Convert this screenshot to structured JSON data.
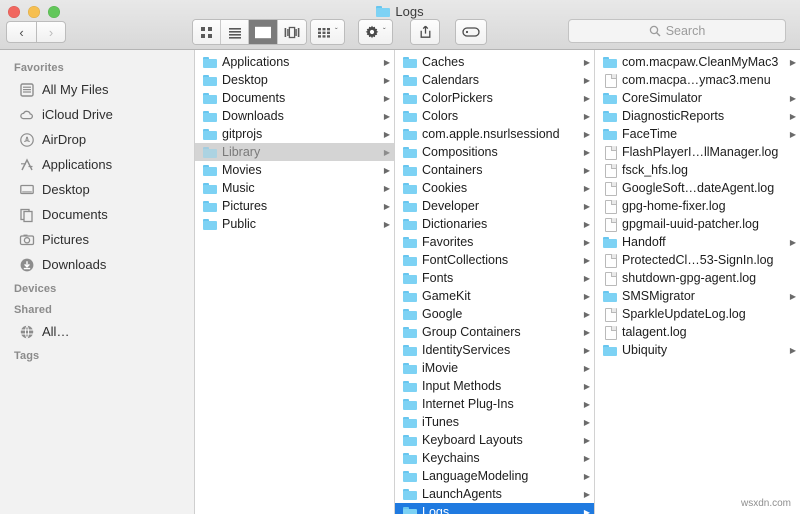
{
  "window": {
    "title": "Logs",
    "title_icon": "folder-icon",
    "traffic_lights": [
      {
        "name": "close-button",
        "color": "#f1675f"
      },
      {
        "name": "minimize-button",
        "color": "#f6bf50"
      },
      {
        "name": "maximize-button",
        "color": "#62c75a"
      }
    ]
  },
  "toolbar": {
    "back_label": "‹",
    "forward_label": "›",
    "views": [
      {
        "name": "icon-view-button",
        "icon": "grid-icon",
        "active": false
      },
      {
        "name": "list-view-button",
        "icon": "list-icon",
        "active": false
      },
      {
        "name": "column-view-button",
        "icon": "columns-icon",
        "active": true
      },
      {
        "name": "coverflow-view-button",
        "icon": "coverflow-icon",
        "active": false
      }
    ],
    "arrange_label": "",
    "arrange_icon": "arrange-icon",
    "action_icon": "gear-icon",
    "share_icon": "share-icon",
    "tag_icon": "tag-icon",
    "chevron": "ˇ"
  },
  "search": {
    "placeholder": "Search",
    "icon": "search-icon",
    "value": ""
  },
  "sidebar": {
    "sections": [
      {
        "header": "Favorites",
        "items": [
          {
            "label": "All My Files",
            "icon": "all-my-files-icon"
          },
          {
            "label": "iCloud Drive",
            "icon": "cloud-icon"
          },
          {
            "label": "AirDrop",
            "icon": "airdrop-icon"
          },
          {
            "label": "Applications",
            "icon": "applications-icon"
          },
          {
            "label": "Desktop",
            "icon": "desktop-icon"
          },
          {
            "label": "Documents",
            "icon": "documents-icon"
          },
          {
            "label": "Pictures",
            "icon": "pictures-icon"
          },
          {
            "label": "Downloads",
            "icon": "downloads-icon"
          }
        ]
      },
      {
        "header": "Devices",
        "items": []
      },
      {
        "header": "Shared",
        "items": [
          {
            "label": "All…",
            "icon": "globe-icon"
          }
        ]
      },
      {
        "header": "Tags",
        "items": []
      }
    ]
  },
  "columns": [
    {
      "name": "column-home",
      "items": [
        {
          "label": "Applications",
          "type": "folder",
          "arrow": true,
          "selected": "none"
        },
        {
          "label": "Desktop",
          "type": "folder",
          "arrow": true,
          "selected": "none"
        },
        {
          "label": "Documents",
          "type": "folder",
          "arrow": true,
          "selected": "none"
        },
        {
          "label": "Downloads",
          "type": "folder",
          "arrow": true,
          "selected": "none"
        },
        {
          "label": "gitprojs",
          "type": "folder",
          "arrow": true,
          "selected": "none"
        },
        {
          "label": "Library",
          "type": "folder",
          "arrow": true,
          "selected": "gray"
        },
        {
          "label": "Movies",
          "type": "folder",
          "arrow": true,
          "selected": "none"
        },
        {
          "label": "Music",
          "type": "folder",
          "arrow": true,
          "selected": "none"
        },
        {
          "label": "Pictures",
          "type": "folder",
          "arrow": true,
          "selected": "none"
        },
        {
          "label": "Public",
          "type": "folder",
          "arrow": true,
          "selected": "none"
        }
      ]
    },
    {
      "name": "column-library",
      "items": [
        {
          "label": "Caches",
          "type": "folder",
          "arrow": true,
          "selected": "none"
        },
        {
          "label": "Calendars",
          "type": "folder",
          "arrow": true,
          "selected": "none"
        },
        {
          "label": "ColorPickers",
          "type": "folder",
          "arrow": true,
          "selected": "none"
        },
        {
          "label": "Colors",
          "type": "folder",
          "arrow": true,
          "selected": "none"
        },
        {
          "label": "com.apple.nsurlsessiond",
          "type": "folder",
          "arrow": true,
          "selected": "none"
        },
        {
          "label": "Compositions",
          "type": "folder",
          "arrow": true,
          "selected": "none"
        },
        {
          "label": "Containers",
          "type": "folder",
          "arrow": true,
          "selected": "none"
        },
        {
          "label": "Cookies",
          "type": "folder",
          "arrow": true,
          "selected": "none"
        },
        {
          "label": "Developer",
          "type": "folder",
          "arrow": true,
          "selected": "none"
        },
        {
          "label": "Dictionaries",
          "type": "folder",
          "arrow": true,
          "selected": "none"
        },
        {
          "label": "Favorites",
          "type": "folder",
          "arrow": true,
          "selected": "none"
        },
        {
          "label": "FontCollections",
          "type": "folder",
          "arrow": true,
          "selected": "none"
        },
        {
          "label": "Fonts",
          "type": "folder",
          "arrow": true,
          "selected": "none"
        },
        {
          "label": "GameKit",
          "type": "folder",
          "arrow": true,
          "selected": "none"
        },
        {
          "label": "Google",
          "type": "folder",
          "arrow": true,
          "selected": "none"
        },
        {
          "label": "Group Containers",
          "type": "folder",
          "arrow": true,
          "selected": "none"
        },
        {
          "label": "IdentityServices",
          "type": "folder",
          "arrow": true,
          "selected": "none"
        },
        {
          "label": "iMovie",
          "type": "folder",
          "arrow": true,
          "selected": "none"
        },
        {
          "label": "Input Methods",
          "type": "folder",
          "arrow": true,
          "selected": "none"
        },
        {
          "label": "Internet Plug-Ins",
          "type": "folder",
          "arrow": true,
          "selected": "none"
        },
        {
          "label": "iTunes",
          "type": "folder",
          "arrow": true,
          "selected": "none"
        },
        {
          "label": "Keyboard Layouts",
          "type": "folder",
          "arrow": true,
          "selected": "none"
        },
        {
          "label": "Keychains",
          "type": "folder",
          "arrow": true,
          "selected": "none"
        },
        {
          "label": "LanguageModeling",
          "type": "folder",
          "arrow": true,
          "selected": "none"
        },
        {
          "label": "LaunchAgents",
          "type": "folder",
          "arrow": true,
          "selected": "none"
        },
        {
          "label": "Logs",
          "type": "folder",
          "arrow": true,
          "selected": "blue"
        }
      ]
    },
    {
      "name": "column-logs",
      "items": [
        {
          "label": "com.macpaw.CleanMyMac3",
          "type": "folder",
          "arrow": true,
          "selected": "none"
        },
        {
          "label": "com.macpa…ymac3.menu",
          "type": "doc",
          "arrow": false,
          "selected": "none"
        },
        {
          "label": "CoreSimulator",
          "type": "folder",
          "arrow": true,
          "selected": "none"
        },
        {
          "label": "DiagnosticReports",
          "type": "folder",
          "arrow": true,
          "selected": "none"
        },
        {
          "label": "FaceTime",
          "type": "folder",
          "arrow": true,
          "selected": "none"
        },
        {
          "label": "FlashPlayerI…llManager.log",
          "type": "doc",
          "arrow": false,
          "selected": "none"
        },
        {
          "label": "fsck_hfs.log",
          "type": "doc",
          "arrow": false,
          "selected": "none"
        },
        {
          "label": "GoogleSoft…dateAgent.log",
          "type": "doc",
          "arrow": false,
          "selected": "none"
        },
        {
          "label": "gpg-home-fixer.log",
          "type": "doc",
          "arrow": false,
          "selected": "none"
        },
        {
          "label": "gpgmail-uuid-patcher.log",
          "type": "doc",
          "arrow": false,
          "selected": "none"
        },
        {
          "label": "Handoff",
          "type": "folder",
          "arrow": true,
          "selected": "none"
        },
        {
          "label": "ProtectedCl…53-SignIn.log",
          "type": "doc",
          "arrow": false,
          "selected": "none"
        },
        {
          "label": "shutdown-gpg-agent.log",
          "type": "doc",
          "arrow": false,
          "selected": "none"
        },
        {
          "label": "SMSMigrator",
          "type": "folder",
          "arrow": true,
          "selected": "none"
        },
        {
          "label": "SparkleUpdateLog.log",
          "type": "doc",
          "arrow": false,
          "selected": "none"
        },
        {
          "label": "talagent.log",
          "type": "doc",
          "arrow": false,
          "selected": "none"
        },
        {
          "label": "Ubiquity",
          "type": "folder",
          "arrow": true,
          "selected": "none"
        }
      ]
    }
  ],
  "watermark": "wsxdn.com",
  "colors": {
    "selection_blue": "#1f7ae0",
    "selection_gray": "#d4d4d4",
    "folder_blue": "#7dd2f4",
    "titlebar": "#e2e2e2"
  }
}
